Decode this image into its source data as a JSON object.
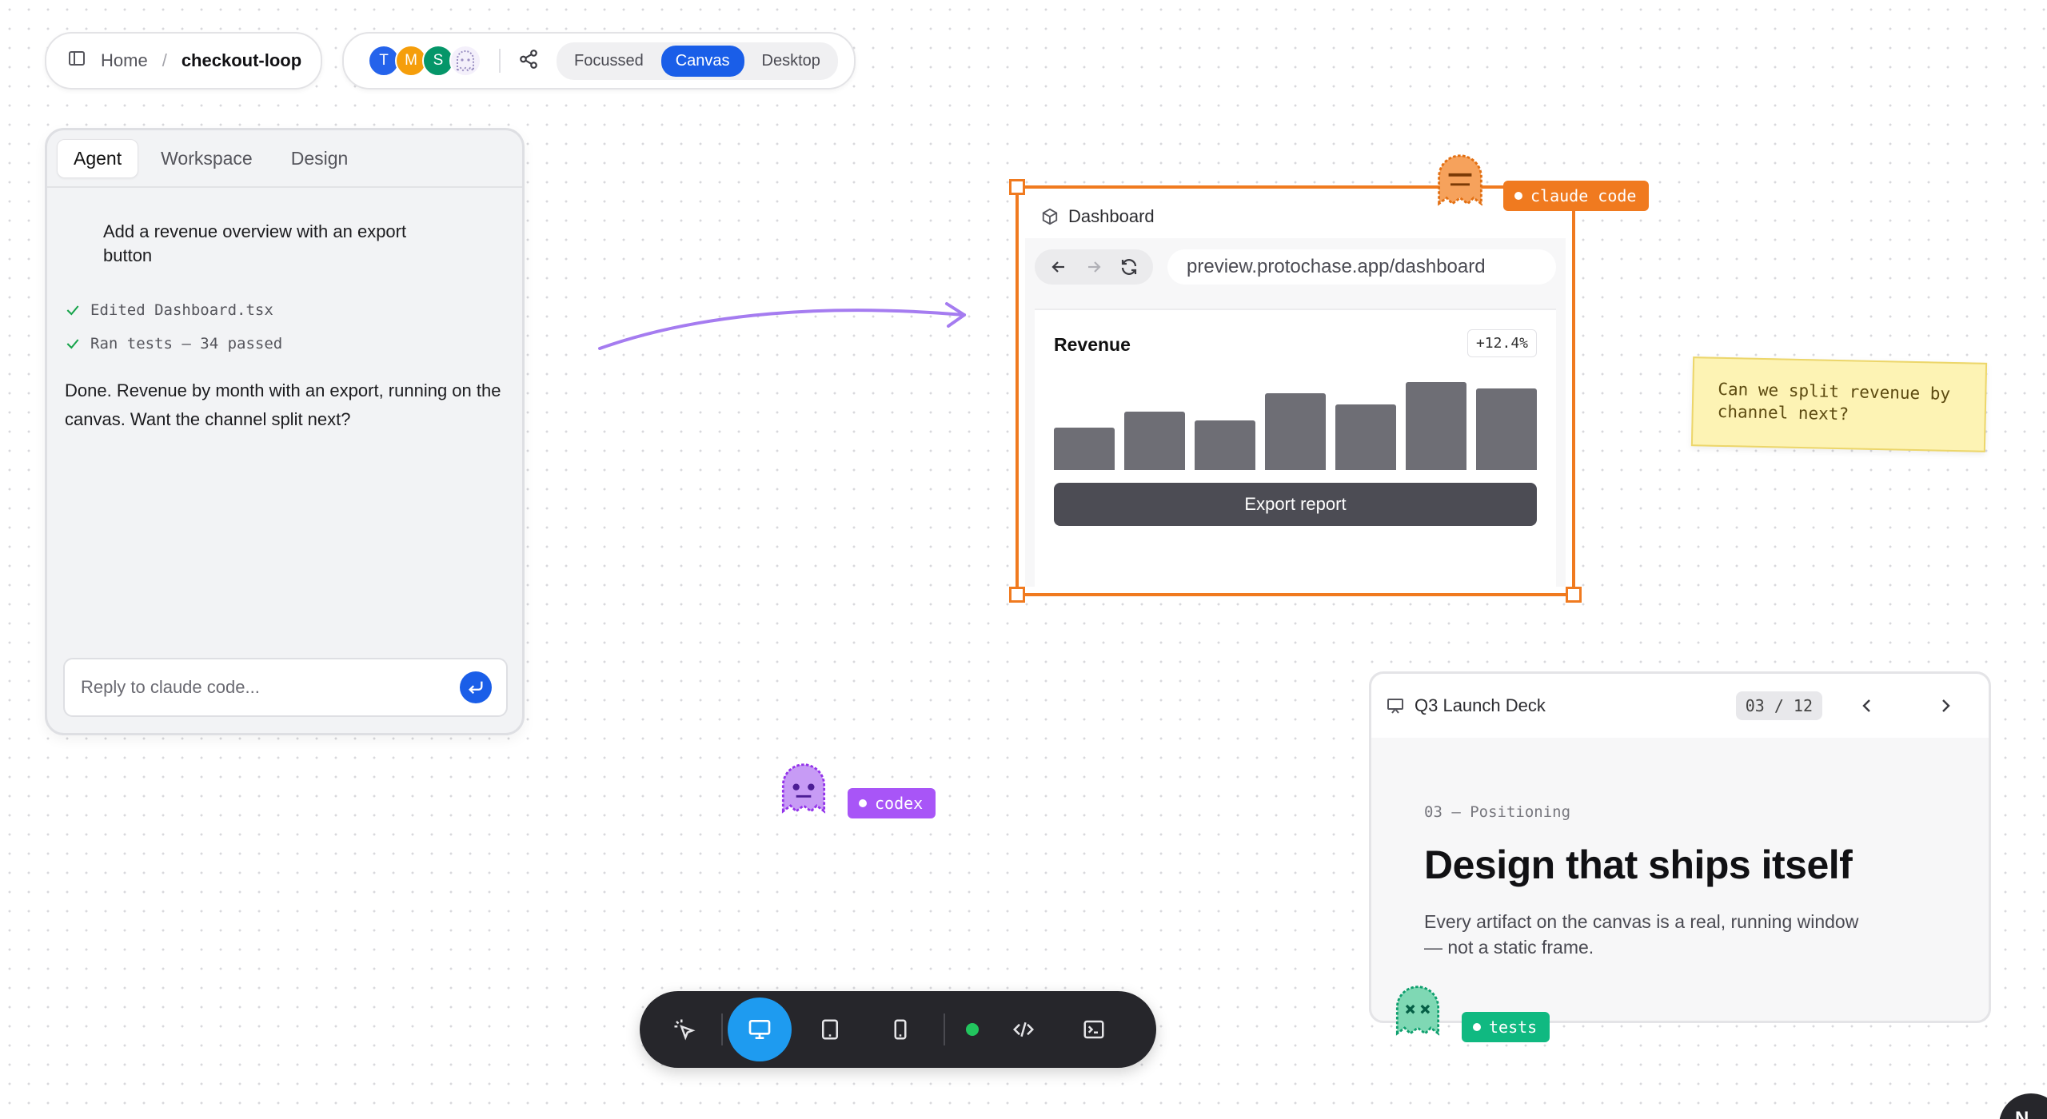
{
  "breadcrumb": {
    "home": "Home",
    "separator": "/",
    "current": "checkout-loop"
  },
  "presence": {
    "avatars": [
      {
        "initial": "T",
        "color": "#2563eb"
      },
      {
        "initial": "M",
        "color": "#f59e0b"
      },
      {
        "initial": "S",
        "color": "#059669"
      }
    ],
    "view_modes": [
      "Focussed",
      "Canvas",
      "Desktop"
    ],
    "active_view": "Canvas"
  },
  "agent_panel": {
    "tabs": [
      "Agent",
      "Workspace",
      "Design"
    ],
    "active_tab": "Agent",
    "prompt": "Add a revenue overview with an export button",
    "log": [
      "Edited Dashboard.tsx",
      "Ran tests — 34 passed"
    ],
    "reply": "Done. Revenue by month with an export, running on the canvas. Want the channel split next?",
    "input_placeholder": "Reply to claude code..."
  },
  "dashboard": {
    "title": "Dashboard",
    "url": "preview.protochase.app/dashboard",
    "card_title": "Revenue",
    "change_badge": "+12.4%",
    "bar_levels": [
      0.48,
      0.66,
      0.56,
      0.87,
      0.75,
      1.0,
      0.93
    ],
    "export_label": "Export report"
  },
  "agents": {
    "claude": {
      "label": "claude code",
      "color": "#f07a1f"
    },
    "codex": {
      "label": "codex",
      "color": "#a855f7"
    },
    "tests": {
      "label": "tests",
      "color": "#10b981"
    }
  },
  "sticky_note": "Can we split revenue by channel next?",
  "deck": {
    "title": "Q3 Launch Deck",
    "counter": "03 / 12",
    "kicker": "03 — Positioning",
    "slide_title": "Design that ships itself",
    "slide_body": "Every artifact on the canvas is a real, running window — not a static frame."
  },
  "corner_fab": "N"
}
